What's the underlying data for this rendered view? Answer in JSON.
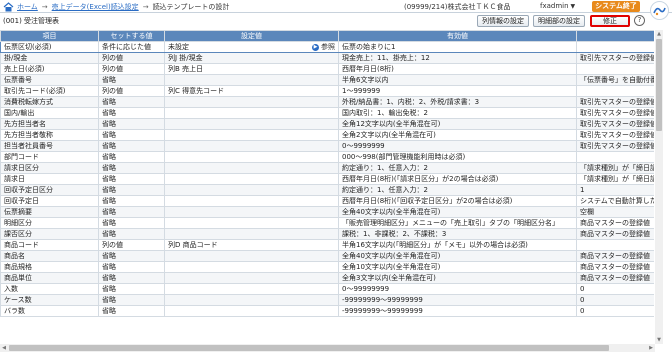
{
  "breadcrumb": {
    "home": "ホーム",
    "sep": "→",
    "link2": "売上データ(Excel)読込設定",
    "current": "読込テンプレートの設計"
  },
  "header": {
    "company": "(09999/214)株式会社ＴＫＣ食品",
    "user": "fxadmin",
    "user_caret": "▼",
    "end_button": "システム終了"
  },
  "subheader": {
    "title": "(001) 受注管理表",
    "col_info_button": "列情報の設定",
    "detail_button": "明細部の設定",
    "edit_button": "修正",
    "help": "?"
  },
  "table": {
    "headers": [
      "項目",
      "セットする値",
      "設定値",
      "有効値",
      ""
    ],
    "browse_label": "参照",
    "rows": [
      [
        "伝票区切(必須)",
        "条件に応じた値",
        "未設定",
        "伝票の始まりに1",
        ""
      ],
      [
        "掛/現金",
        "列の値",
        "列J 掛/現金",
        "現金売上：11、掛売上：12",
        "取引先マスターの登録値"
      ],
      [
        "売上日(必須)",
        "列の値",
        "列B 売上日",
        "西暦年月日(8桁)",
        ""
      ],
      [
        "伝票番号",
        "省略",
        "",
        "半角6文字以内",
        "「伝票番号」を自動付番"
      ],
      [
        "取引先コード(必須)",
        "列の値",
        "列C 得意先コード",
        "1～999999",
        ""
      ],
      [
        "消費税転嫁方式",
        "省略",
        "",
        "外税/納品書：1、内税：2、外税/請求書：3",
        "取引先マスターの登録値"
      ],
      [
        "国内/輸出",
        "省略",
        "",
        "国内取引：1、輸出免税：2",
        "取引先マスターの登録値"
      ],
      [
        "先方担当者名",
        "省略",
        "",
        "全角12文字以内(全半角混在可)",
        "取引先マスターの登録値"
      ],
      [
        "先方担当者敬称",
        "省略",
        "",
        "全角2文字以内(全半角混在可)",
        "取引先マスターの登録値"
      ],
      [
        "担当者社員番号",
        "省略",
        "",
        "0～9999999",
        "取引先マスターの登録値"
      ],
      [
        "部門コード",
        "省略",
        "",
        "000～998(部門管理機能利用時は必須)",
        ""
      ],
      [
        "請求日区分",
        "省略",
        "",
        "約定通り：1、任意入力：2",
        "「請求種別」が「締日請求"
      ],
      [
        "請求日",
        "省略",
        "",
        "西暦年月日(8桁)(「請求日区分」が2の場合は必須)",
        "「請求種別」が「締日請求"
      ],
      [
        "回収予定日区分",
        "省略",
        "",
        "約定通り：1、任意入力：2",
        "1"
      ],
      [
        "回収予定日",
        "省略",
        "",
        "西暦年月日(8桁)(「回収予定日区分」が2の場合は必須)",
        "システムで自動計算した"
      ],
      [
        "伝票摘要",
        "省略",
        "",
        "全角40文字以内(全半角混在可)",
        "空欄"
      ],
      [
        "明細区分",
        "省略",
        "",
        "「販売管理明細区分」メニューの「売上取引」タブの「明細区分名」",
        "商品マスターの登録値"
      ],
      [
        "課否区分",
        "省略",
        "",
        "課税：1、非課税：2、不課税：3",
        "商品マスターの登録値"
      ],
      [
        "商品コード",
        "列の値",
        "列D 商品コード",
        "半角16文字以内(「明細区分」が「メモ」以外の場合は必須)",
        ""
      ],
      [
        "商品名",
        "省略",
        "",
        "全角40文字以内(全半角混在可)",
        "商品マスターの登録値"
      ],
      [
        "商品規格",
        "省略",
        "",
        "全角10文字以内(全半角混在可)",
        "商品マスターの登録値"
      ],
      [
        "商品単位",
        "省略",
        "",
        "全角3文字以内(全半角混在可)",
        "商品マスターの登録値"
      ],
      [
        "入数",
        "省略",
        "",
        "0～99999999",
        "0"
      ],
      [
        "ケース数",
        "省略",
        "",
        "-99999999～99999999",
        "0"
      ],
      [
        "バラ数",
        "省略",
        "",
        "-99999999～99999999",
        "0"
      ]
    ]
  },
  "colors": {
    "header_bg": "#5b87bb",
    "link": "#2a6cc4",
    "end_button": "#e88a1c",
    "edit_border": "#e00000"
  }
}
